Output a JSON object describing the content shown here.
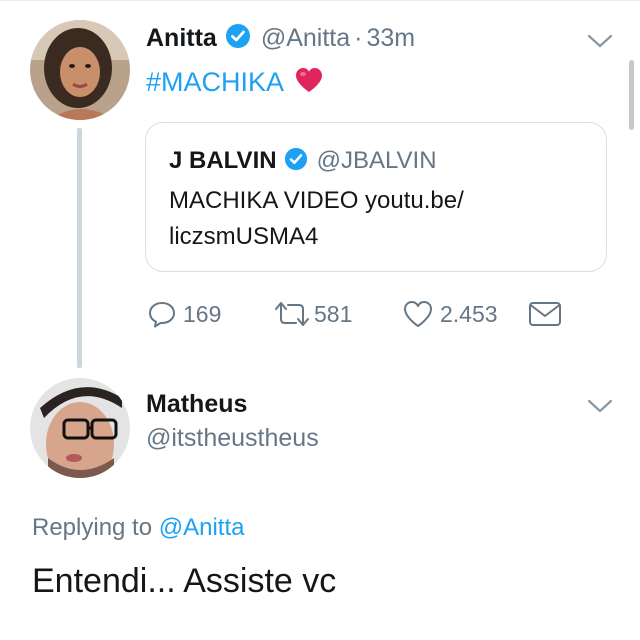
{
  "tweet": {
    "author_name": "Anitta",
    "author_handle": "@Anitta",
    "separator": "·",
    "time": "33m",
    "text": "#MACHIKA",
    "emoji": "heart",
    "quoted": {
      "author_name": "J BALVIN",
      "author_handle": "@JBALVIN",
      "text": "MACHIKA VIDEO youtu.be/ liczsmUSMA4"
    },
    "actions": {
      "replies": "169",
      "retweets": "581",
      "likes": "2.453"
    }
  },
  "reply": {
    "author_name": "Matheus",
    "author_handle": "@itstheustheus",
    "replying_prefix": "Replying to",
    "replying_mention": "@Anitta",
    "text": "Entendi... Assiste vc"
  },
  "colors": {
    "link": "#1da1f2",
    "secondary": "#657786",
    "verified": "#1da1f2",
    "heart": "#e0245e"
  },
  "icons": [
    "verified-badge-icon",
    "chevron-down-icon",
    "heart-emoji-icon",
    "reply-icon",
    "retweet-icon",
    "like-icon",
    "direct-message-icon"
  ]
}
